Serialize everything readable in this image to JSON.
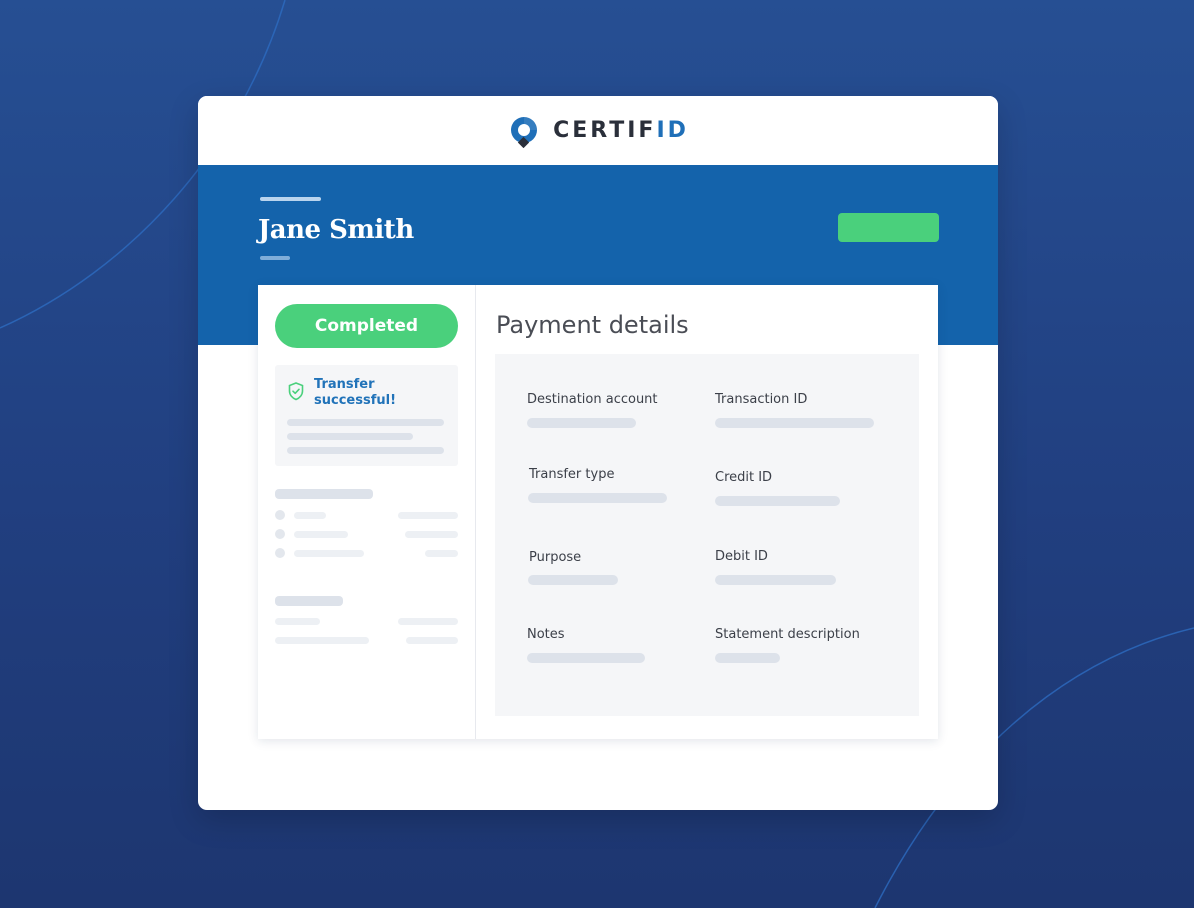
{
  "logo": {
    "text_main": "CERTIF",
    "text_accent": "ID",
    "accent_color": "#1f6fb8"
  },
  "header": {
    "name": "Jane Smith"
  },
  "status": {
    "label": "Completed",
    "color": "#4ad07c"
  },
  "notice": {
    "text": "Transfer successful!",
    "icon": "shield-check-icon"
  },
  "payment": {
    "title": "Payment details",
    "fields": [
      {
        "label": "Destination account"
      },
      {
        "label": "Transaction ID"
      },
      {
        "label": "Transfer type"
      },
      {
        "label": "Credit ID"
      },
      {
        "label": "Purpose"
      },
      {
        "label": "Debit ID"
      },
      {
        "label": "Notes"
      },
      {
        "label": "Statement description"
      }
    ]
  },
  "colors": {
    "background": "#23468a",
    "banner": "#1463ab",
    "success": "#4ad07c"
  }
}
